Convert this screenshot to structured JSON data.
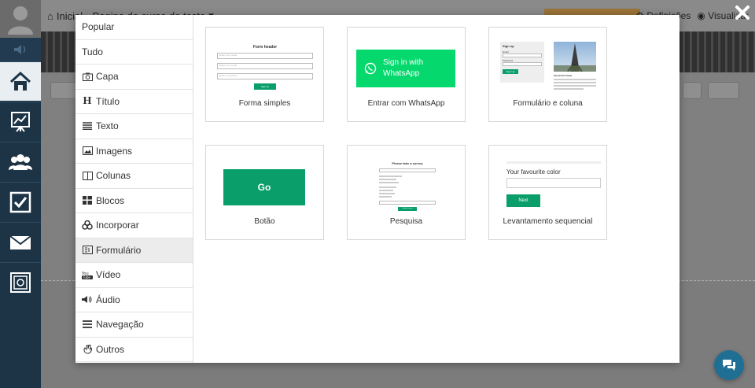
{
  "topbar": {
    "home": "Inicial",
    "course": "Pagina de curso de teste",
    "right_a": "Definições",
    "right_b": "Visualizar"
  },
  "categories": [
    {
      "label": "Popular",
      "icon": ""
    },
    {
      "label": "Tudo",
      "icon": ""
    },
    {
      "label": "Capa",
      "icon": "camera-icon"
    },
    {
      "label": "Título",
      "icon": "heading-icon"
    },
    {
      "label": "Texto",
      "icon": "text-lines-icon"
    },
    {
      "label": "Imagens",
      "icon": "image-icon"
    },
    {
      "label": "Colunas",
      "icon": "columns-icon"
    },
    {
      "label": "Blocos",
      "icon": "blocks-icon"
    },
    {
      "label": "Incorporar",
      "icon": "embed-icon"
    },
    {
      "label": "Formulário",
      "icon": "form-icon"
    },
    {
      "label": "Vídeo",
      "icon": "youtube-icon"
    },
    {
      "label": "Áudio",
      "icon": "speaker-icon"
    },
    {
      "label": "Navegação",
      "icon": "menu-icon"
    },
    {
      "label": "Outros",
      "icon": "misc-icon"
    }
  ],
  "active_category": "Formulário",
  "tiles": {
    "simple_form": {
      "caption": "Forma simples",
      "header": "Form header",
      "field1": "Enter your name",
      "field2": "Enter your email",
      "field3": "Enter your phone",
      "button": "Sign up"
    },
    "whatsapp": {
      "caption": "Entrar com WhatsApp",
      "button": "Sign in with WhatsApp"
    },
    "form_column": {
      "caption": "Formulário e coluna",
      "signup": "Sign up",
      "email": "Email",
      "password": "Password",
      "button": "Sign Up",
      "about": "About the Tower"
    },
    "button": {
      "caption": "Botão",
      "label": "Go"
    },
    "survey": {
      "caption": "Pesquisa",
      "title": "Please take a survey",
      "button": "Submit survey"
    },
    "sequential": {
      "caption": "Levantamento sequencial",
      "question": "Your favourite color",
      "button": "Next"
    }
  },
  "colors": {
    "green": "#0a9e6a",
    "whatsapp_green": "#05d96e",
    "sidebar": "#1d3447",
    "chat": "#1f6f94"
  }
}
